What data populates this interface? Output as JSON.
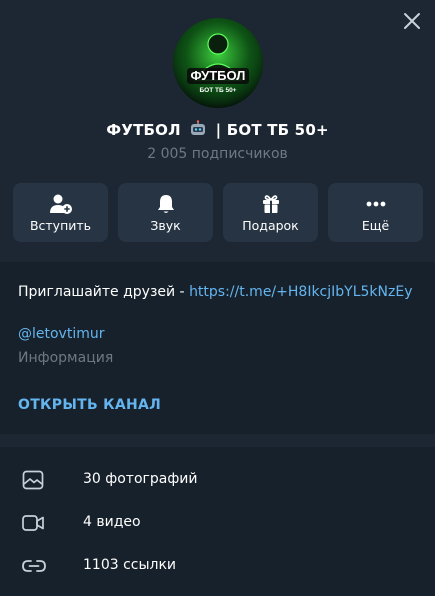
{
  "channel": {
    "title": "ФУТБОЛ",
    "title_suffix": "| БОТ ТБ 50+",
    "subscribers": "2 005 подписчиков",
    "avatar_text_main": "ФУТБОЛ",
    "avatar_text_sub": "БОТ ТБ 50+"
  },
  "actions": [
    {
      "label": "Вступить",
      "icon": "add-user-icon"
    },
    {
      "label": "Звук",
      "icon": "bell-icon"
    },
    {
      "label": "Подарок",
      "icon": "gift-icon"
    },
    {
      "label": "Ещё",
      "icon": "more-icon"
    }
  ],
  "info": {
    "description_text": "Приглашайте друзей - ",
    "description_link": "https://t.me/+H8IkcjIbYL5kNzEy",
    "handle": "@letovtimur",
    "handle_label": "Информация",
    "open_channel": "ОТКРЫТЬ КАНАЛ"
  },
  "media": [
    {
      "label": "30 фотографий",
      "icon": "photo-icon"
    },
    {
      "label": "4 видео",
      "icon": "video-icon"
    },
    {
      "label": "1103 ссылки",
      "icon": "link-icon"
    }
  ],
  "colors": {
    "background": "#1d2733",
    "panel": "#17212b",
    "button": "#263444",
    "accent": "#64b5ef",
    "muted": "#6d7883"
  }
}
